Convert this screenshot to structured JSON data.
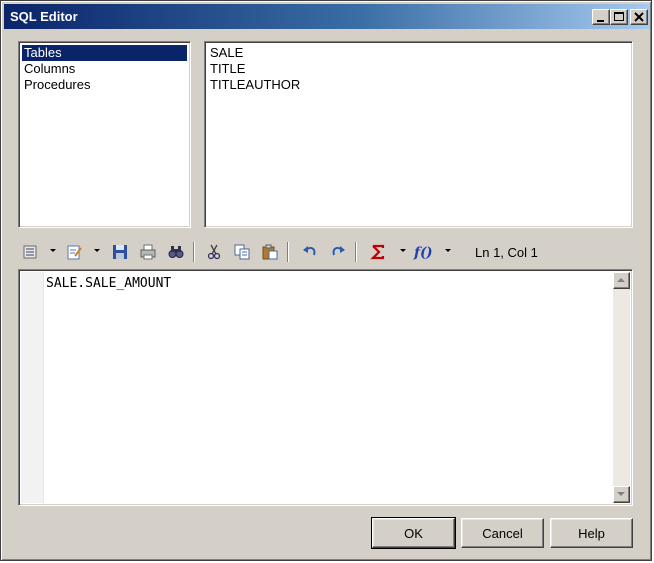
{
  "window": {
    "title": "SQL Editor",
    "controls": [
      "minimize",
      "maximize",
      "close"
    ]
  },
  "categories": {
    "items": [
      {
        "label": "Tables",
        "selected": true
      },
      {
        "label": "Columns",
        "selected": false
      },
      {
        "label": "Procedures",
        "selected": false
      }
    ]
  },
  "objects": {
    "items": [
      "SALE",
      "TITLE",
      "TITLEAUTHOR"
    ]
  },
  "toolbar": {
    "icons": [
      "editor-menu-icon",
      "edit-with-icon",
      "save-icon",
      "print-icon",
      "find-icon",
      "cut-icon",
      "copy-icon",
      "paste-icon",
      "undo-icon",
      "redo-icon",
      "sum-icon",
      "function-icon"
    ],
    "status": "Ln 1, Col 1"
  },
  "editor": {
    "text": "SALE.SALE_AMOUNT"
  },
  "buttons": {
    "ok": "OK",
    "cancel": "Cancel",
    "help": "Help"
  },
  "colors": {
    "title_bar_start": "#0a246a",
    "title_bar_end": "#a6caf0",
    "selection": "#0a246a",
    "face": "#d4d0c8"
  }
}
